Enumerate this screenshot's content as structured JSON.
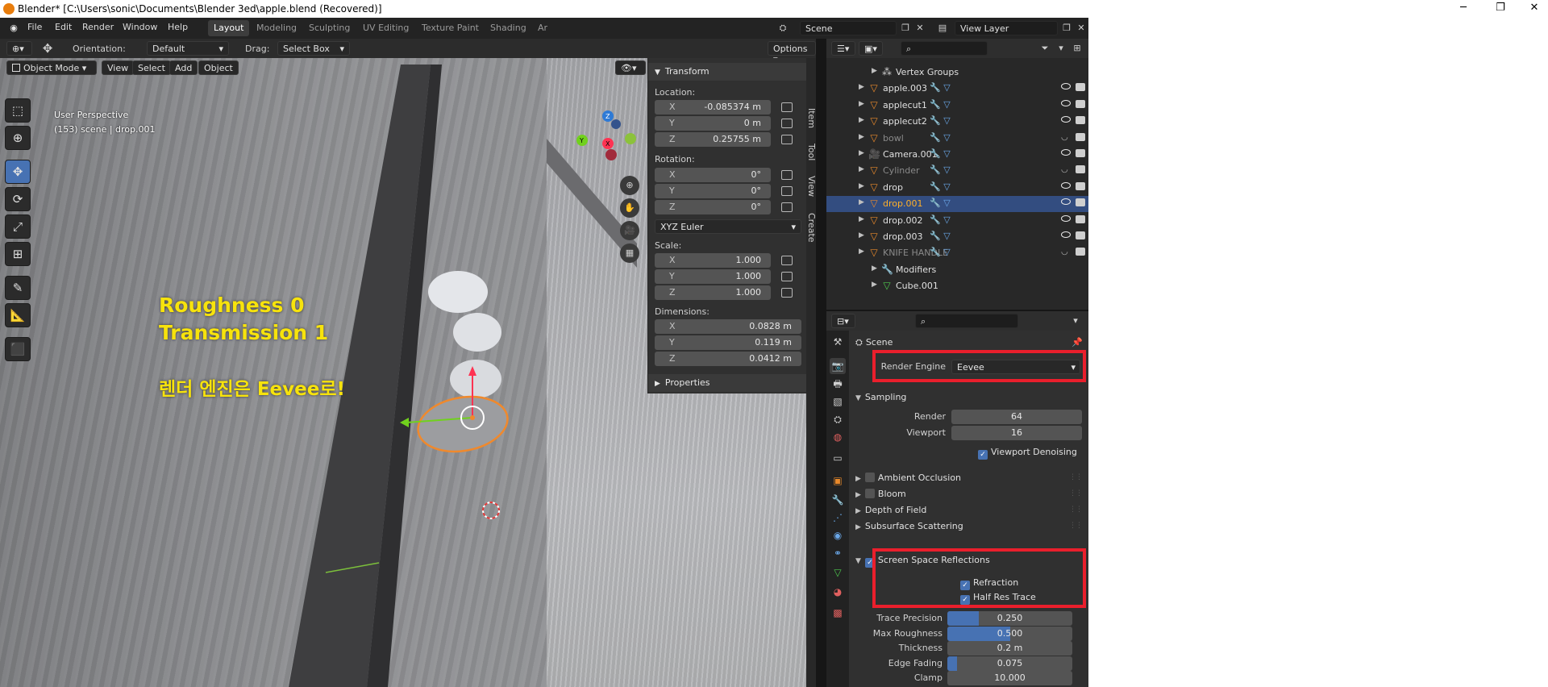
{
  "window": {
    "title": "Blender* [C:\\Users\\sonic\\Documents\\Blender 3ed\\apple.blend (Recovered)]",
    "controls": [
      "─",
      "❐",
      "✕"
    ]
  },
  "menu": [
    "File",
    "Edit",
    "Render",
    "Window",
    "Help"
  ],
  "workspaces": {
    "active": "Layout",
    "tabs": [
      "Layout",
      "Modeling",
      "Sculpting",
      "UV Editing",
      "Texture Paint",
      "Shading",
      "Ar"
    ]
  },
  "scene_field": "Scene",
  "view_layer_field": "View Layer",
  "tool_header": {
    "orientation_label": "Orientation:",
    "orientation_value": "Default",
    "drag_label": "Drag:",
    "drag_value": "Select Box",
    "options_label": "Options"
  },
  "viewport_header": {
    "mode": "Object Mode",
    "menus": [
      "View",
      "Select",
      "Add",
      "Object"
    ]
  },
  "viewport": {
    "info_line1": "User Perspective",
    "info_line2": "(153) scene | drop.001",
    "annotation_line1": "Roughness 0",
    "annotation_line2": "Transmission 1",
    "annotation_line3_korean": "렌더 엔진은 ",
    "annotation_line3_bold": "Eevee",
    "annotation_line3_end": "로!",
    "annotation_color": "#f7e30c",
    "gizmo_labels": [
      "Z",
      "Y",
      "X"
    ]
  },
  "sidebar_panel": {
    "transform_title": "Transform",
    "location_label": "Location:",
    "location": [
      {
        "axis": "X",
        "value": "-0.085374 m"
      },
      {
        "axis": "Y",
        "value": "0 m"
      },
      {
        "axis": "Z",
        "value": "0.25755 m"
      }
    ],
    "rotation_label": "Rotation:",
    "rotation": [
      {
        "axis": "X",
        "value": "0°"
      },
      {
        "axis": "Y",
        "value": "0°"
      },
      {
        "axis": "Z",
        "value": "0°"
      }
    ],
    "rotation_mode": "XYZ Euler",
    "scale_label": "Scale:",
    "scale": [
      {
        "axis": "X",
        "value": "1.000"
      },
      {
        "axis": "Y",
        "value": "1.000"
      },
      {
        "axis": "Z",
        "value": "1.000"
      }
    ],
    "dimensions_label": "Dimensions:",
    "dimensions": [
      {
        "axis": "X",
        "value": "0.0828 m"
      },
      {
        "axis": "Y",
        "value": "0.119 m"
      },
      {
        "axis": "Z",
        "value": "0.0412 m"
      }
    ],
    "properties_title": "Properties",
    "tabs": [
      "Item",
      "Tool",
      "View",
      "Create"
    ]
  },
  "outliner": {
    "rows": [
      {
        "name": "Vertex Groups",
        "indent": 2,
        "icon": "vertex-groups",
        "state": "normal"
      },
      {
        "name": "apple.003",
        "indent": 1,
        "icon": "object",
        "state": "normal"
      },
      {
        "name": "applecut1",
        "indent": 1,
        "icon": "object",
        "state": "normal"
      },
      {
        "name": "applecut2",
        "indent": 1,
        "icon": "object",
        "state": "normal"
      },
      {
        "name": "bowl",
        "indent": 1,
        "icon": "object",
        "state": "dim"
      },
      {
        "name": "Camera.001",
        "indent": 1,
        "icon": "camera",
        "state": "normal"
      },
      {
        "name": "Cylinder",
        "indent": 1,
        "icon": "object",
        "state": "dim"
      },
      {
        "name": "drop",
        "indent": 1,
        "icon": "object",
        "state": "normal"
      },
      {
        "name": "drop.001",
        "indent": 1,
        "icon": "object",
        "state": "selected"
      },
      {
        "name": "drop.002",
        "indent": 1,
        "icon": "object",
        "state": "normal"
      },
      {
        "name": "drop.003",
        "indent": 1,
        "icon": "object",
        "state": "normal"
      },
      {
        "name": "KNIFE HANDLE",
        "indent": 1,
        "icon": "object",
        "state": "dim"
      },
      {
        "name": "Modifiers",
        "indent": 2,
        "icon": "wrench",
        "state": "normal"
      },
      {
        "name": "Cube.001",
        "indent": 2,
        "icon": "mesh",
        "state": "normal"
      }
    ]
  },
  "properties": {
    "context": "Scene",
    "render_engine_label": "Render Engine",
    "render_engine_value": "Eevee",
    "sampling_title": "Sampling",
    "render_label": "Render",
    "render_value": "64",
    "viewport_label": "Viewport",
    "viewport_value": "16",
    "viewport_denoising": "Viewport Denoising",
    "sections": [
      {
        "title": "Ambient Occlusion",
        "checkbox": true,
        "checked": false
      },
      {
        "title": "Bloom",
        "checkbox": true,
        "checked": false
      },
      {
        "title": "Depth of Field",
        "checkbox": false
      },
      {
        "title": "Subsurface Scattering",
        "checkbox": false
      }
    ],
    "ssr_title": "Screen Space Reflections",
    "refraction": "Refraction",
    "half_res_trace": "Half Res Trace",
    "params": [
      {
        "label": "Trace Precision",
        "value": "0.250",
        "fill": 0.25
      },
      {
        "label": "Max Roughness",
        "value": "0.500",
        "fill": 0.5
      },
      {
        "label": "Thickness",
        "value": "0.2 m",
        "fill": 0
      },
      {
        "label": "Edge Fading",
        "value": "0.075",
        "fill": 0.075
      },
      {
        "label": "Clamp",
        "value": "10.000",
        "fill": 0
      }
    ]
  },
  "colors": {
    "accent_blue": "#4772b3",
    "selected_row": "#334d80",
    "highlight_red": "#ea1f2c",
    "object_orange": "#e8892b",
    "selection_outline": "#f0892c"
  }
}
